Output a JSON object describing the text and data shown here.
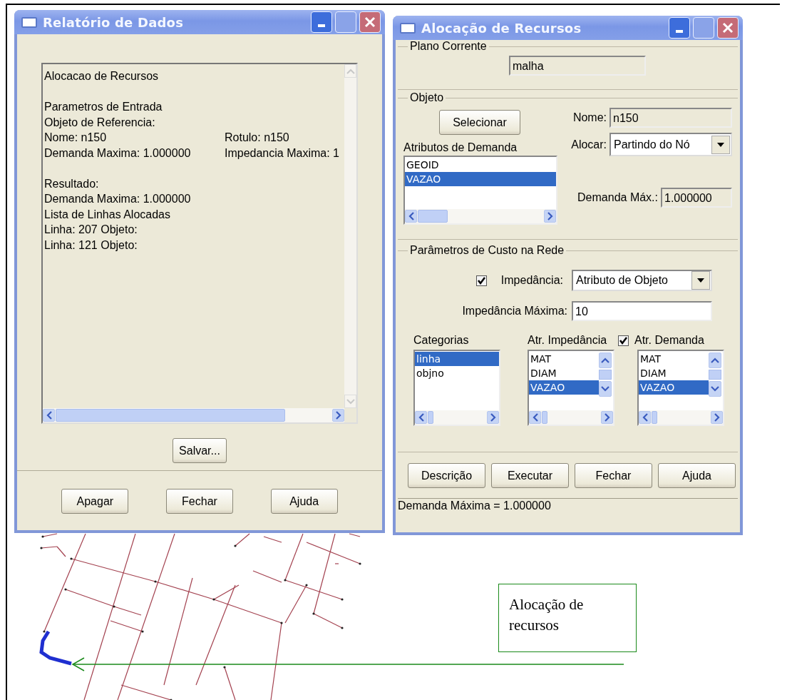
{
  "report_window": {
    "title": "Relatório de Dados",
    "paragraphs": [
      [
        [
          "Alocacao de Recursos"
        ]
      ],
      [
        [
          "Parametros de Entrada"
        ],
        [
          "Objeto de Referencia:"
        ],
        [
          "Nome: n150",
          "Rotulo: n150"
        ],
        [
          "Demanda Maxima: 1.000000",
          "Impedancia Maxima: 1"
        ]
      ],
      [
        [
          "Resultado:"
        ],
        [
          "Demanda Maxima: 1.000000"
        ],
        [
          "Lista de Linhas Alocadas"
        ],
        [
          "Linha: 207  Objeto:"
        ],
        [
          "Linha: 121  Objeto:"
        ]
      ]
    ],
    "save_button": "Salvar...",
    "buttons": [
      "Apagar",
      "Fechar",
      "Ajuda"
    ]
  },
  "allocation_window": {
    "title": "Alocação de Recursos",
    "current_plan": {
      "legend": "Plano Corrente",
      "value": "malha"
    },
    "object": {
      "legend": "Objeto",
      "select_button": "Selecionar",
      "name_label": "Nome:",
      "name_value": "n150",
      "demand_attributes_label": "Atributos de Demanda",
      "demand_attributes": [
        {
          "label": "GEOID",
          "selected": false
        },
        {
          "label": "VAZAO",
          "selected": true
        }
      ],
      "allocate_label": "Alocar:",
      "allocate_value": "Partindo do Nó",
      "max_demand_label": "Demanda Máx.:",
      "max_demand_value": "1.000000"
    },
    "cost_parameters": {
      "legend": "Parâmetros de Custo na Rede",
      "impedance": {
        "checked": true,
        "label": "Impedância:",
        "value": "Atributo de Objeto"
      },
      "max_impedance_label": "Impedância Máxima:",
      "max_impedance_value": "10",
      "lists": [
        {
          "label": "Categorias",
          "items": [
            {
              "label": "linha",
              "selected": true
            },
            {
              "label": "objno",
              "selected": false
            }
          ]
        },
        {
          "label": "Atr. Impedância",
          "items": [
            {
              "label": "MAT",
              "selected": false
            },
            {
              "label": "DIAM",
              "selected": false
            },
            {
              "label": "VAZAO",
              "selected": true
            }
          ]
        },
        {
          "label": "Atr. Demanda",
          "checked": true,
          "items": [
            {
              "label": "MAT",
              "selected": false
            },
            {
              "label": "DIAM",
              "selected": false
            },
            {
              "label": "VAZAO",
              "selected": true
            }
          ]
        }
      ]
    },
    "buttons": [
      "Descrição",
      "Executar",
      "Fechar",
      "Ajuda"
    ],
    "status_bar": "Demanda Máxima = 1.000000"
  },
  "callout": {
    "text": "Alocação de recursos"
  }
}
